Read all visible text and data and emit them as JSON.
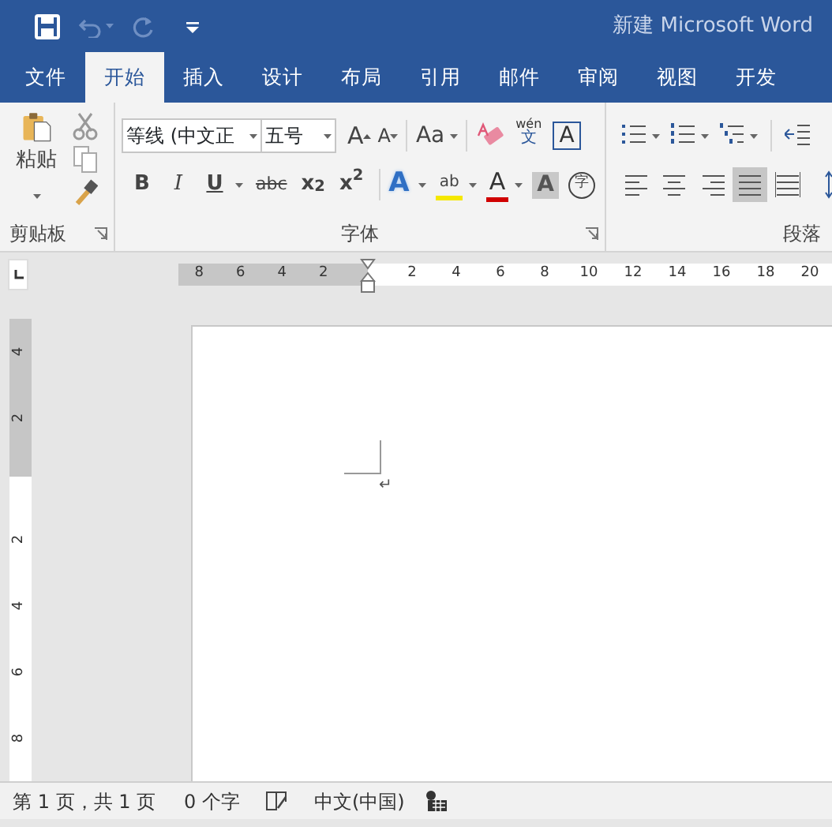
{
  "title_bar": {
    "title": "新建 Microsoft Word"
  },
  "tabs": [
    {
      "label": "文件",
      "selected": false
    },
    {
      "label": "开始",
      "selected": true
    },
    {
      "label": "插入",
      "selected": false
    },
    {
      "label": "设计",
      "selected": false
    },
    {
      "label": "布局",
      "selected": false
    },
    {
      "label": "引用",
      "selected": false
    },
    {
      "label": "邮件",
      "selected": false
    },
    {
      "label": "审阅",
      "selected": false
    },
    {
      "label": "视图",
      "selected": false
    },
    {
      "label": "开发",
      "selected": false
    }
  ],
  "clipboard": {
    "paste": "粘贴",
    "label": "剪贴板"
  },
  "font": {
    "font_name": "等线 (中文正",
    "font_size": "五号",
    "grow": "A",
    "shrink": "A",
    "change_case": "Aa",
    "phonetic_top": "wén",
    "phonetic_bottom": "文",
    "border": "A",
    "format_buttons": [
      {
        "kind": "bold",
        "label": "B"
      },
      {
        "kind": "italic",
        "label": "I"
      },
      {
        "kind": "underline",
        "label": "U"
      },
      {
        "kind": "strike",
        "label": "abc"
      },
      {
        "kind": "sub",
        "label": "x$_{2}$"
      },
      {
        "kind": "sup",
        "label": "x$^{2}$"
      }
    ],
    "effects": [
      {
        "kind": "effect",
        "label": "A"
      },
      {
        "kind": "highlight",
        "label": "ab"
      },
      {
        "kind": "color",
        "label": "A"
      },
      {
        "kind": "shading",
        "label": "A"
      },
      {
        "kind": "enclose",
        "label": "字"
      }
    ],
    "label": "字体"
  },
  "paragraph": {
    "alignments": [
      {
        "kind": "left",
        "selected": false
      },
      {
        "kind": "center",
        "selected": false
      },
      {
        "kind": "right",
        "selected": false
      },
      {
        "kind": "justify",
        "selected": true
      },
      {
        "kind": "distributed",
        "selected": false
      }
    ],
    "label": "段落"
  },
  "ruler": {
    "left_labels": [
      "8",
      "6",
      "4",
      "2"
    ],
    "right_labels": [
      "2",
      "4",
      "6",
      "8",
      "10",
      "12",
      "14",
      "16",
      "18",
      "20"
    ]
  },
  "vertical_ruler": {
    "top_labels": [
      "4",
      "2"
    ],
    "bottom_labels": [
      "2",
      "4",
      "6",
      "8"
    ]
  },
  "document": {
    "paragraph_mark": "↵"
  },
  "status_bar": {
    "page": "第 1 页，共 1 页",
    "words": "0 个字",
    "language": "中文(中国)"
  }
}
